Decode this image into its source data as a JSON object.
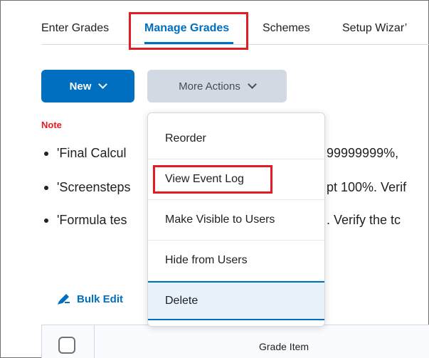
{
  "tabs": [
    {
      "label": "Enter Grades",
      "active": false
    },
    {
      "label": "Manage Grades",
      "active": true
    },
    {
      "label": "Schemes",
      "active": false
    },
    {
      "label": "Setup Wizar’",
      "active": false
    }
  ],
  "toolbar": {
    "new_label": "New",
    "more_actions_label": "More Actions"
  },
  "note": {
    "label": "Note",
    "items": [
      {
        "start": "'Final Calcul",
        "end": "99999999%,"
      },
      {
        "start": "'Screensteps",
        "end": "pt 100%. Verif"
      },
      {
        "start": "'Formula tes",
        "end": ". Verify the tc"
      }
    ]
  },
  "bulk_edit_label": "Bulk Edit",
  "table": {
    "column_header": "Grade Item"
  },
  "menu": {
    "items": [
      "Reorder",
      "View Event Log",
      "Make Visible to Users",
      "Hide from Users",
      "Delete"
    ]
  },
  "colors": {
    "accent": "#006fbf",
    "highlight": "#e31b23",
    "note": "#e31b23",
    "secondary_button": "#d3d9e3"
  }
}
